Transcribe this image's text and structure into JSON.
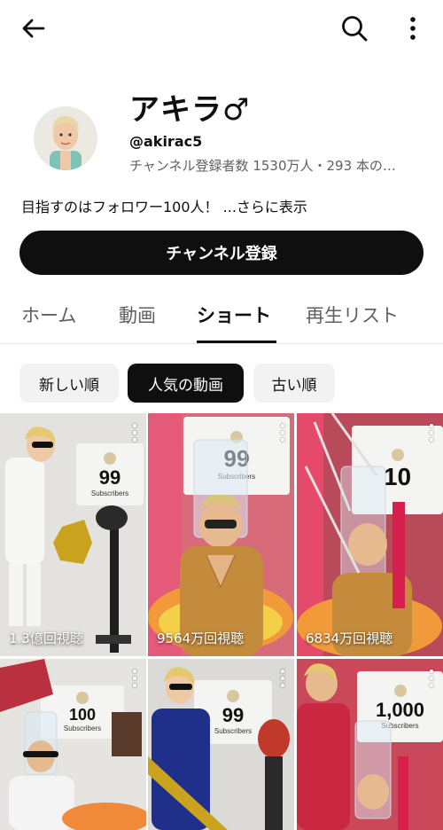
{
  "topbar": {
    "back_icon": "arrow-left-icon",
    "search_icon": "search-icon",
    "more_icon": "more-vertical-icon"
  },
  "channel": {
    "name": "アキラ♂",
    "handle": "@akirac5",
    "stats": "チャンネル登録者数 1530万人・293 本の…",
    "description": "目指すのはフォロワー100人！",
    "description_more": "...さらに表示",
    "subscribe_label": "チャンネル登録"
  },
  "tabs": [
    {
      "label": "ホーム"
    },
    {
      "label": "動画"
    },
    {
      "label": "ショート"
    },
    {
      "label": "再生リスト"
    }
  ],
  "chips": [
    {
      "label": "新しい順"
    },
    {
      "label": "人気の動画"
    },
    {
      "label": "古い順"
    }
  ],
  "shorts": [
    {
      "views": "1.3億回視聴",
      "sign_number": "99",
      "sign_label": "Subscribers"
    },
    {
      "views": "9564万回視聴",
      "sign_number": "99",
      "sign_label": "Subscribers"
    },
    {
      "views": "6834万回視聴",
      "sign_number": "10",
      "sign_label": ""
    },
    {
      "views": "",
      "sign_number": "100",
      "sign_label": "Subscribers"
    },
    {
      "views": "",
      "sign_number": "99",
      "sign_label": "Subscribers"
    },
    {
      "views": "",
      "sign_number": "1,000",
      "sign_label": "Subscribers"
    }
  ],
  "sign_handle": "@akirac5",
  "colors": {
    "primary": "#0f0f0f",
    "secondary_text": "#606060",
    "chip_bg": "#f2f2f2"
  }
}
